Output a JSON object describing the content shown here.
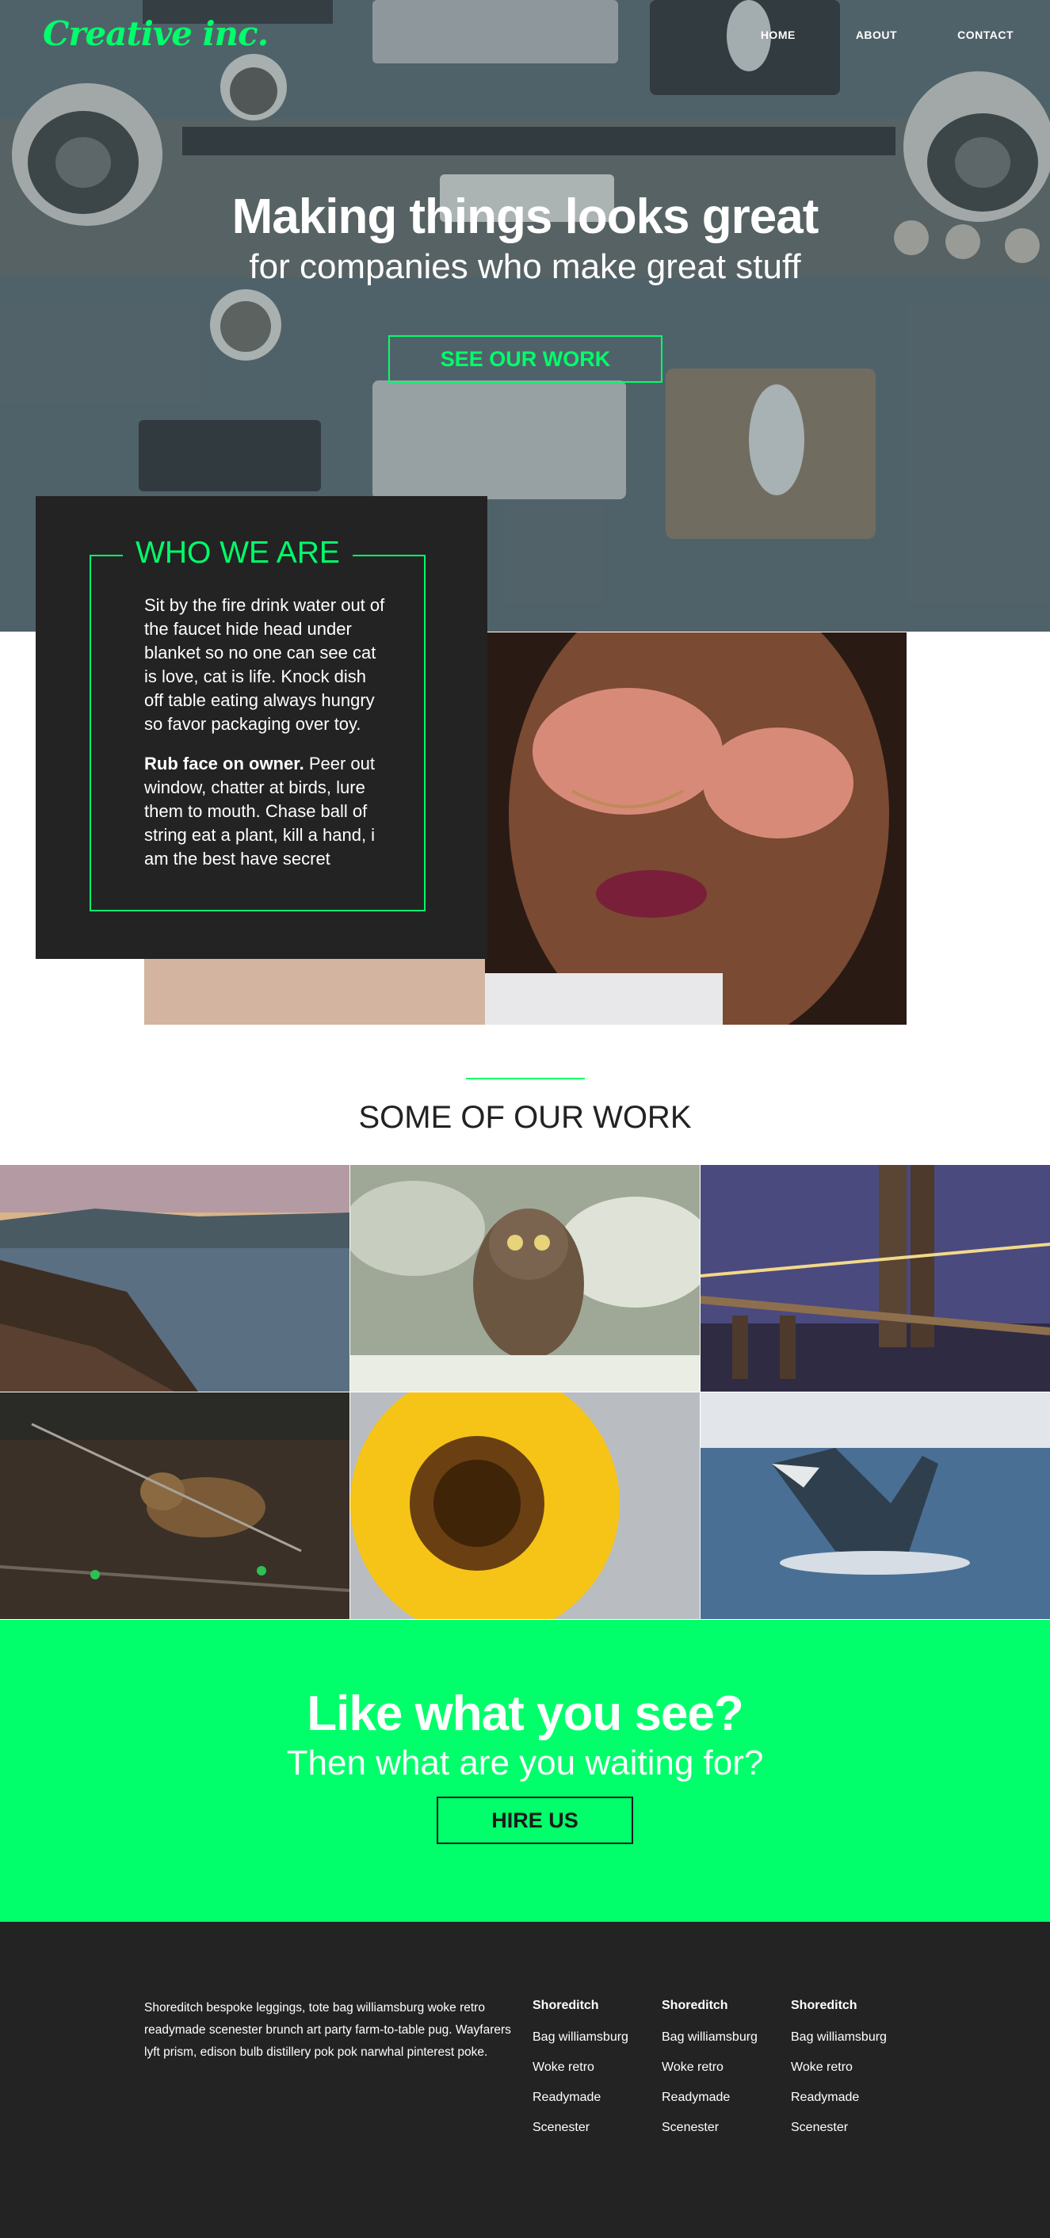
{
  "brand": {
    "logo": "Creative inc.",
    "accent": "#00ff6a",
    "dark": "#232323"
  },
  "nav": {
    "items": [
      "HOME",
      "ABOUT",
      "CONTACT"
    ]
  },
  "hero": {
    "title": "Making things looks great",
    "subtitle": "for companies who make great stuff",
    "button": "SEE OUR WORK"
  },
  "about": {
    "title": "WHO WE ARE",
    "paragraph1": "Sit by the fire drink water out of the faucet hide head under blanket so no one can see cat is love, cat is life. Knock dish off table eating always hungry so favor packaging over toy.",
    "paragraph2_bold": "Rub face on owner.",
    "paragraph2_rest": " Peer out window, chatter at birds, lure them to mouth. Chase ball of string eat a plant, kill a hand, i am the best have secret"
  },
  "work": {
    "title": "SOME OF OUR WORK",
    "tiles": [
      "coastline-photo",
      "owl-photo",
      "bridge-photo",
      "fox-photo",
      "sunflower-photo",
      "whale-photo"
    ]
  },
  "cta": {
    "title": "Like what you see?",
    "subtitle": "Then what are you waiting for?",
    "button": "HIRE US"
  },
  "footer": {
    "text": "Shoreditch bespoke leggings, tote bag williamsburg woke retro readymade scenester brunch art party farm-to-table pug. Wayfarers lyft prism, edison bulb distillery pok pok narwhal pinterest poke.",
    "columns": [
      {
        "heading": "Shoreditch",
        "links": [
          "Bag williamsburg",
          "Woke retro",
          "Readymade",
          "Scenester"
        ]
      },
      {
        "heading": "Shoreditch",
        "links": [
          "Bag williamsburg",
          "Woke retro",
          "Readymade",
          "Scenester"
        ]
      },
      {
        "heading": "Shoreditch",
        "links": [
          "Bag williamsburg",
          "Woke retro",
          "Readymade",
          "Scenester"
        ]
      }
    ]
  }
}
